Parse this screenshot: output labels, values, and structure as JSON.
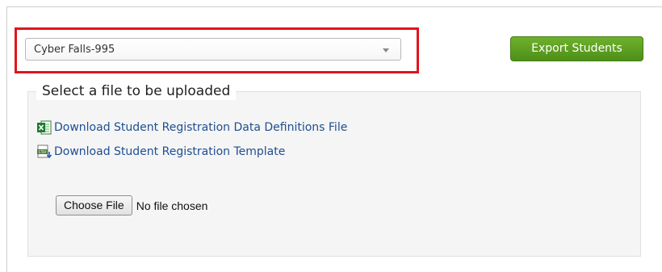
{
  "school_select": {
    "selected": "Cyber Falls-995"
  },
  "export_button": {
    "label": "Export Students"
  },
  "upload": {
    "legend": "Select a file to be uploaded",
    "links": [
      {
        "label": "Download Student Registration Data Definitions File",
        "icon": "excel-file-icon"
      },
      {
        "label": "Download Student Registration Template",
        "icon": "csv-download-icon"
      }
    ],
    "file_input": {
      "button_label": "Choose File",
      "status": "No file chosen"
    }
  },
  "colors": {
    "highlight": "#e0151b",
    "export_button": "#5a9e1f",
    "link": "#1f4e92"
  }
}
